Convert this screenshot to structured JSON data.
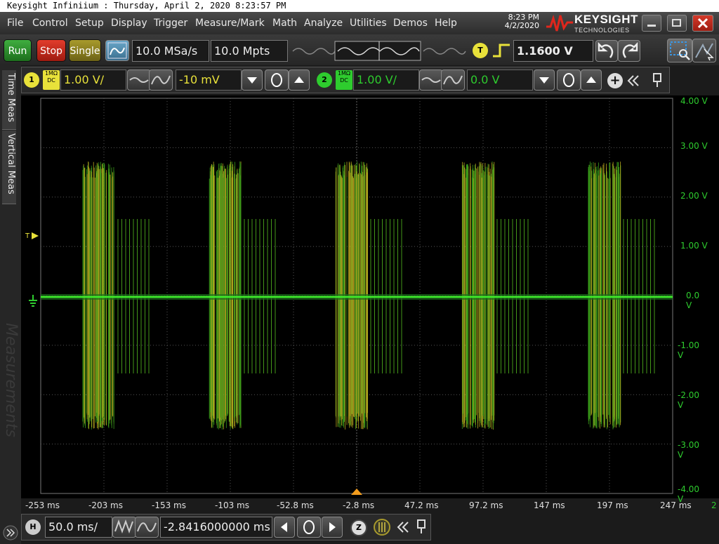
{
  "window": {
    "title": "Keysight Infiniium : Thursday, April 2, 2020 8:23:57 PM"
  },
  "menu": {
    "items": [
      "File",
      "Control",
      "Setup",
      "Display",
      "Trigger",
      "Measure/Mark",
      "Math",
      "Analyze",
      "Utilities",
      "Demos",
      "Help"
    ],
    "clock_time": "8:23 PM",
    "clock_date": "4/2/2020",
    "brand_name": "KEYSIGHT",
    "brand_sub": "TECHNOLOGIES"
  },
  "toolbar": {
    "run_label": "Run",
    "stop_label": "Stop",
    "single_label": "Single",
    "sample_rate": "10.0 MSa/s",
    "memory_depth": "10.0 Mpts",
    "trigger_badge": "T",
    "trigger_level": "1.1600 V"
  },
  "channels": {
    "ch1": {
      "number": "1",
      "impedance": "1MΩ",
      "coupling": "DC",
      "scale": "1.00 V/",
      "offset": "-10 mV",
      "color": "#e8e13a"
    },
    "ch2": {
      "number": "2",
      "impedance": "1MΩ",
      "coupling": "DC",
      "scale": "1.00 V/",
      "offset": "0.0 V",
      "color": "#2ecc2e"
    }
  },
  "side_tabs": {
    "time_meas": "Time Meas",
    "vertical_meas": "Vertical Meas",
    "measurements": "Measurements"
  },
  "display": {
    "trigger_marker": "T",
    "y_labels": [
      "4.00 V",
      "3.00 V",
      "2.00 V",
      "1.00 V",
      "0.0 V",
      "-1.00 V",
      "-2.00 V",
      "-3.00 V",
      "-4.00 V"
    ],
    "x_labels": [
      "-253 ms",
      "-203 ms",
      "-153 ms",
      "-103 ms",
      "-52.8 ms",
      "-2.8 ms",
      "47.2 ms",
      "97.2 ms",
      "147 ms",
      "197 ms",
      "247 ms"
    ],
    "channel_indicator": "2"
  },
  "timebase": {
    "badge": "H",
    "scale": "50.0 ms/",
    "position": "-2.8416000000 ms",
    "zoom_badge": "Z"
  }
}
